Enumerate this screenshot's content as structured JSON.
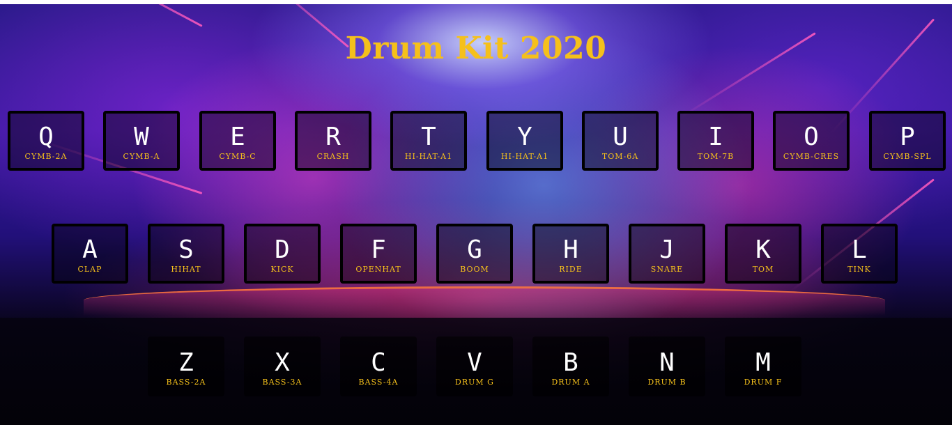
{
  "title": "Drum Kit 2020",
  "colors": {
    "title": "#f5c01b",
    "sound_label": "#f5c01b",
    "key_letter": "#ffffff",
    "key_border": "#000000"
  },
  "rows": [
    [
      {
        "key": "Q",
        "sound": "CYMB-2A"
      },
      {
        "key": "W",
        "sound": "CYMB-A"
      },
      {
        "key": "E",
        "sound": "CYMB-C"
      },
      {
        "key": "R",
        "sound": "CRASH"
      },
      {
        "key": "T",
        "sound": "HI-HAT-A1"
      },
      {
        "key": "Y",
        "sound": "HI-HAT-A1"
      },
      {
        "key": "U",
        "sound": "TOM-6A"
      },
      {
        "key": "I",
        "sound": "TOM-7B"
      },
      {
        "key": "O",
        "sound": "CYMB-CRES"
      },
      {
        "key": "P",
        "sound": "CYMB-SPL"
      }
    ],
    [
      {
        "key": "A",
        "sound": "CLAP"
      },
      {
        "key": "S",
        "sound": "HIHAT"
      },
      {
        "key": "D",
        "sound": "KICK"
      },
      {
        "key": "F",
        "sound": "OPENHAT"
      },
      {
        "key": "G",
        "sound": "BOOM"
      },
      {
        "key": "H",
        "sound": "RIDE"
      },
      {
        "key": "J",
        "sound": "SNARE"
      },
      {
        "key": "K",
        "sound": "TOM"
      },
      {
        "key": "L",
        "sound": "TINK"
      }
    ],
    [
      {
        "key": "Z",
        "sound": "BASS-2A"
      },
      {
        "key": "X",
        "sound": "BASS-3A"
      },
      {
        "key": "C",
        "sound": "BASS-4A"
      },
      {
        "key": "V",
        "sound": "DRUM G"
      },
      {
        "key": "B",
        "sound": "DRUM A"
      },
      {
        "key": "N",
        "sound": "DRUM B"
      },
      {
        "key": "M",
        "sound": "DRUM F"
      }
    ]
  ]
}
